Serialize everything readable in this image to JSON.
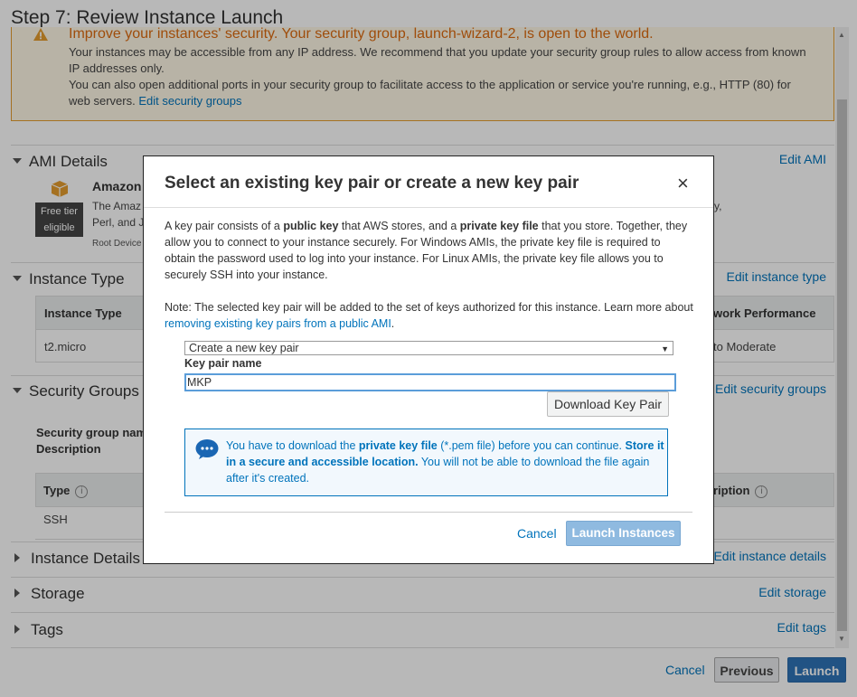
{
  "page": {
    "title": "Step 7: Review Instance Launch",
    "warning": {
      "title": "Improve your instances' security. Your security group, launch-wizard-2, is open to the world.",
      "line1": "Your instances may be accessible from any IP address. We recommend that you update your security group rules to allow access from known IP addresses only.",
      "line2_text": "You can also open additional ports in your security group to facilitate access to the application or service you're running, e.g., HTTP (80) for web servers.",
      "line2_link": "Edit security groups"
    },
    "sections": {
      "ami": {
        "label": "AMI Details",
        "edit": "Edit AMI",
        "name_partial": "Amazon",
        "desc_partial1": "The Amaz",
        "desc_partial1_right": "y,",
        "desc_partial2": "Perl, and J",
        "root_partial": "Root Device",
        "badge_line1": "Free tier",
        "badge_line2": "eligible"
      },
      "instance_type": {
        "label": "Instance Type",
        "edit": "Edit instance type",
        "col1": "Instance Type",
        "col_right": "work Performance",
        "row_val": "t2.micro",
        "row_right": "to Moderate"
      },
      "security": {
        "label": "Security Groups",
        "edit": "Edit security groups",
        "sg_name_partial": "Security group nam",
        "desc_label": "Description",
        "col_type": "Type",
        "col_right": "ription",
        "row_type": "SSH"
      },
      "instance_details": {
        "label": "Instance Details",
        "edit": "Edit instance details"
      },
      "storage": {
        "label": "Storage",
        "edit": "Edit storage"
      },
      "tags": {
        "label": "Tags",
        "edit": "Edit tags"
      }
    },
    "footer": {
      "cancel": "Cancel",
      "previous": "Previous",
      "launch": "Launch"
    }
  },
  "modal": {
    "title": "Select an existing key pair or create a new key pair",
    "close": "×",
    "para1": {
      "t1": "A key pair consists of a ",
      "b1": "public key",
      "t2": " that AWS stores, and a ",
      "b2": "private key file",
      "t3": " that you store. Together, they allow you to connect to your instance securely. For Windows AMIs, the private key file is required to obtain the password used to log into your instance. For Linux AMIs, the private key file allows you to securely SSH into your instance."
    },
    "para2": {
      "text": "Note: The selected key pair will be added to the set of keys authorized for this instance. Learn more about ",
      "link": "removing existing key pairs from a public AMI",
      "end": "."
    },
    "select_value": "Create a new key pair",
    "key_label": "Key pair name",
    "key_value": "MKP",
    "download_button": "Download Key Pair",
    "info": {
      "t1": "You have to download the ",
      "b1": "private key file",
      "t2": " (*.pem file) before you can continue. ",
      "b2": "Store it in a secure and accessible location.",
      "t3": " You will not be able to download the file again after it's created."
    },
    "cancel": "Cancel",
    "launch": "Launch Instances"
  },
  "colors": {
    "link": "#0073bb",
    "warning": "#dd6b10",
    "primary": "#2f73b7",
    "primary_disabled": "#8fbae0"
  }
}
